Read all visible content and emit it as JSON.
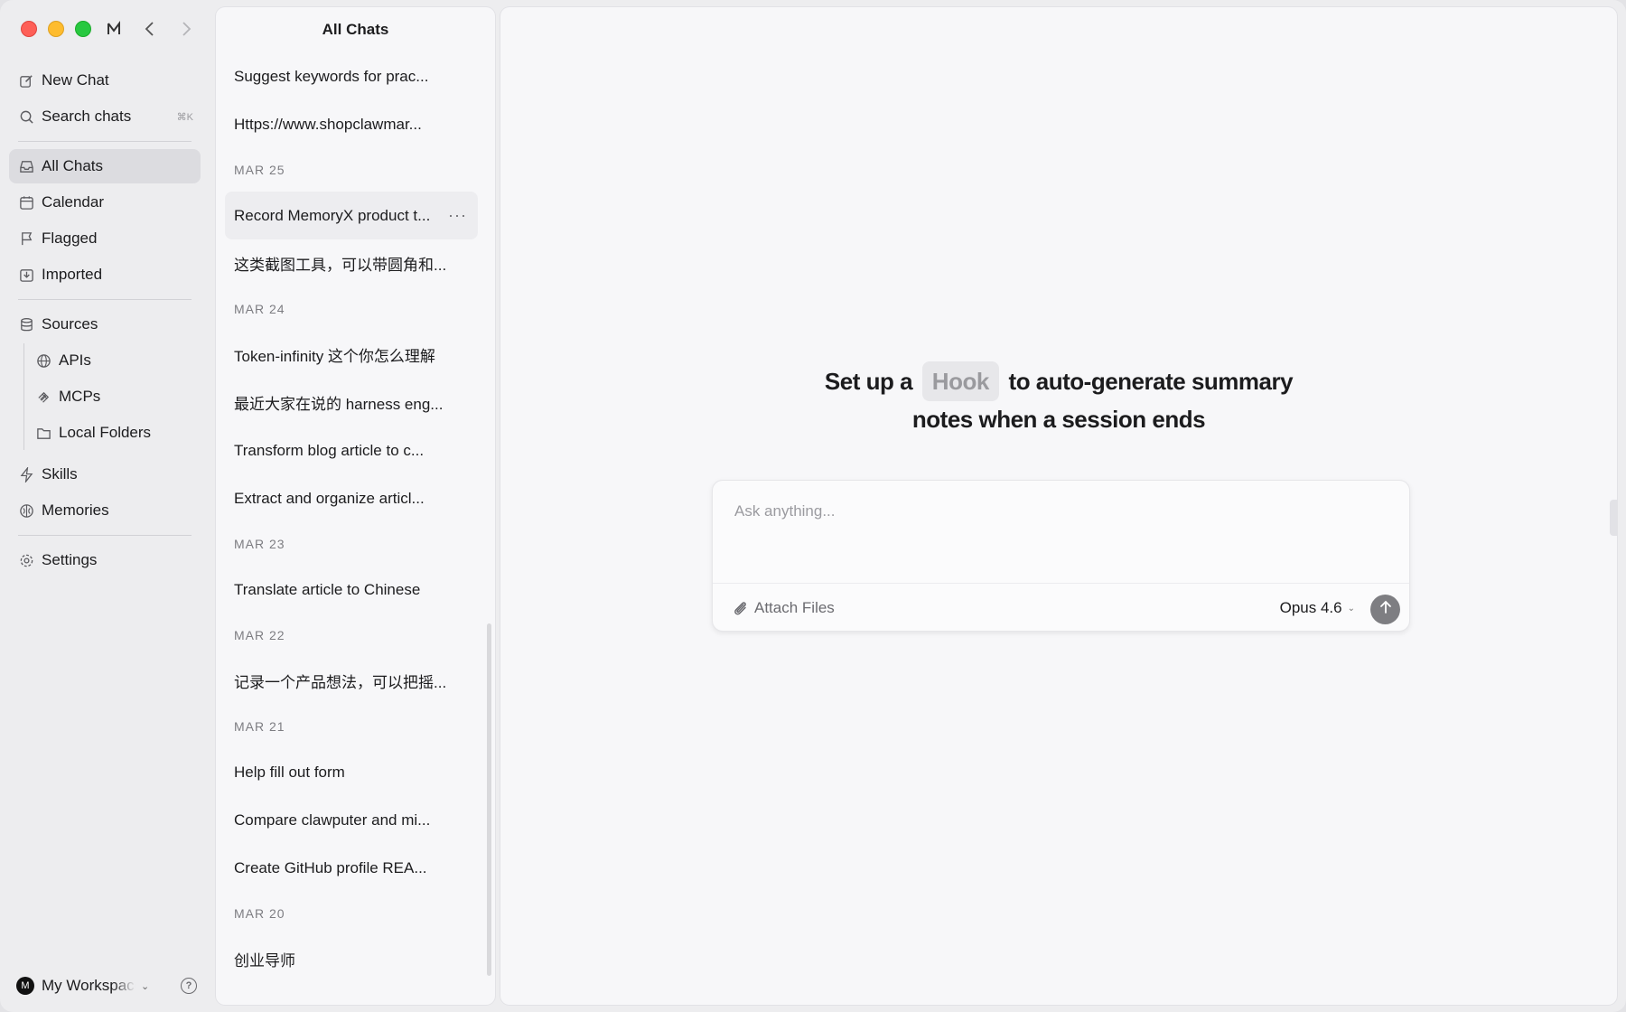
{
  "sidebar": {
    "new_chat": "New Chat",
    "search": "Search chats",
    "search_shortcut": "⌘K",
    "all_chats": "All Chats",
    "calendar": "Calendar",
    "flagged": "Flagged",
    "imported": "Imported",
    "sources": "Sources",
    "apis": "APIs",
    "mcps": "MCPs",
    "local_folders": "Local Folders",
    "skills": "Skills",
    "memories": "Memories",
    "settings": "Settings"
  },
  "workspace": {
    "avatar": "M",
    "name": "My Workspace"
  },
  "list": {
    "title": "All Chats",
    "items": [
      "Suggest keywords for prac...",
      "Https://www.shopclawmar...",
      "MAR 25",
      "Record MemoryX product t...",
      "这类截图工具，可以带圆角和...",
      "MAR 24",
      "Token-infinity 这个你怎么理解",
      "最近大家在说的 harness eng...",
      "Transform blog article to c...",
      "Extract and organize articl...",
      "MAR 23",
      "Translate article to Chinese",
      "MAR 22",
      "记录一个产品想法，可以把摇...",
      "MAR 21",
      "Help fill out form",
      "Compare clawputer and mi...",
      "Create GitHub profile REA...",
      "MAR 20",
      "创业导师"
    ]
  },
  "main": {
    "hero_pre": "Set up a",
    "hero_pill": "Hook",
    "hero_post": "to auto-generate summary",
    "hero_line2": "notes when a session ends",
    "composer_placeholder": "Ask anything...",
    "attach_label": "Attach Files",
    "model_label": "Opus 4.6"
  },
  "colors": {
    "traffic_red": "#fe5f57",
    "traffic_yellow": "#febc2e",
    "traffic_green": "#28c840",
    "send_button": "#7e7e82"
  }
}
